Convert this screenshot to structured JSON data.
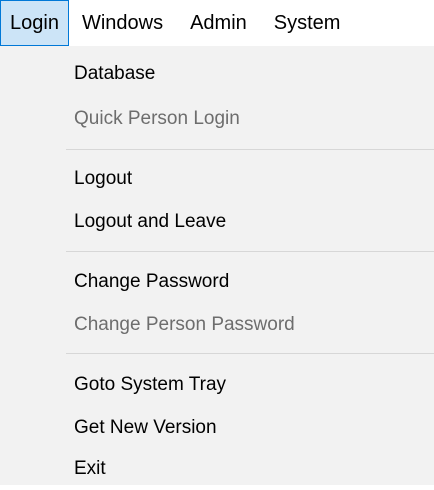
{
  "menubar": {
    "items": [
      {
        "label": "Login",
        "active": true
      },
      {
        "label": "Windows",
        "active": false
      },
      {
        "label": "Admin",
        "active": false
      },
      {
        "label": "System",
        "active": false
      }
    ]
  },
  "login_menu": {
    "groups": [
      [
        {
          "label": "Database",
          "enabled": true
        },
        {
          "label": "Quick Person Login",
          "enabled": false
        }
      ],
      [
        {
          "label": "Logout",
          "enabled": true
        },
        {
          "label": "Logout and Leave",
          "enabled": true
        }
      ],
      [
        {
          "label": "Change Password",
          "enabled": true
        },
        {
          "label": "Change Person Password",
          "enabled": false
        }
      ],
      [
        {
          "label": "Goto System Tray",
          "enabled": true
        },
        {
          "label": "Get New Version",
          "enabled": true
        },
        {
          "label": "Exit",
          "enabled": true
        }
      ]
    ]
  },
  "colors": {
    "menu_background": "#f2f2f2",
    "active_highlight": "#cce4f7",
    "active_border": "#0078d7",
    "disabled_text": "#6d6d6d",
    "separator": "#d7d7d7"
  }
}
